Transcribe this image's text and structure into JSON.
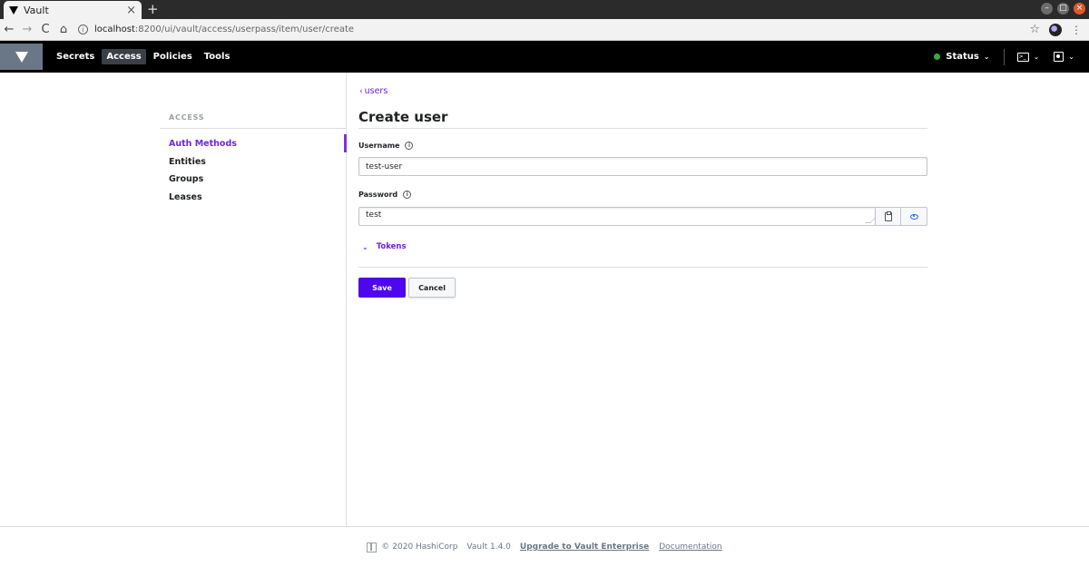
{
  "browser": {
    "tab_title": "Vault",
    "tab_close": "×",
    "new_tab": "+",
    "url_host": "localhost",
    "url_path": ":8200/ui/vault/access/userpass/item/user/create",
    "back": "←",
    "forward": "→",
    "reload": "C",
    "home": "⌂",
    "bookmark": "☆",
    "menu": "⋮"
  },
  "header": {
    "nav": [
      "Secrets",
      "Access",
      "Policies",
      "Tools"
    ],
    "active_nav": "Access",
    "status_label": "Status",
    "status_color": "#2eb039"
  },
  "sidebar": {
    "heading": "ACCESS",
    "items": [
      {
        "label": "Auth Methods",
        "active": true
      },
      {
        "label": "Entities",
        "active": false
      },
      {
        "label": "Groups",
        "active": false
      },
      {
        "label": "Leases",
        "active": false
      }
    ]
  },
  "main": {
    "breadcrumb": "users",
    "title": "Create user",
    "username_label": "Username",
    "username_value": "test-user",
    "password_label": "Password",
    "password_value": "test",
    "tokens_label": "Tokens",
    "save_label": "Save",
    "cancel_label": "Cancel"
  },
  "footer": {
    "copyright": "© 2020 HashiCorp",
    "version": "Vault 1.4.0",
    "upgrade_link": "Upgrade to Vault Enterprise",
    "docs_link": "Documentation"
  },
  "colors": {
    "accent_purple": "#4f06ed",
    "link_purple": "#6f1fe0",
    "header_bg": "#000000"
  }
}
